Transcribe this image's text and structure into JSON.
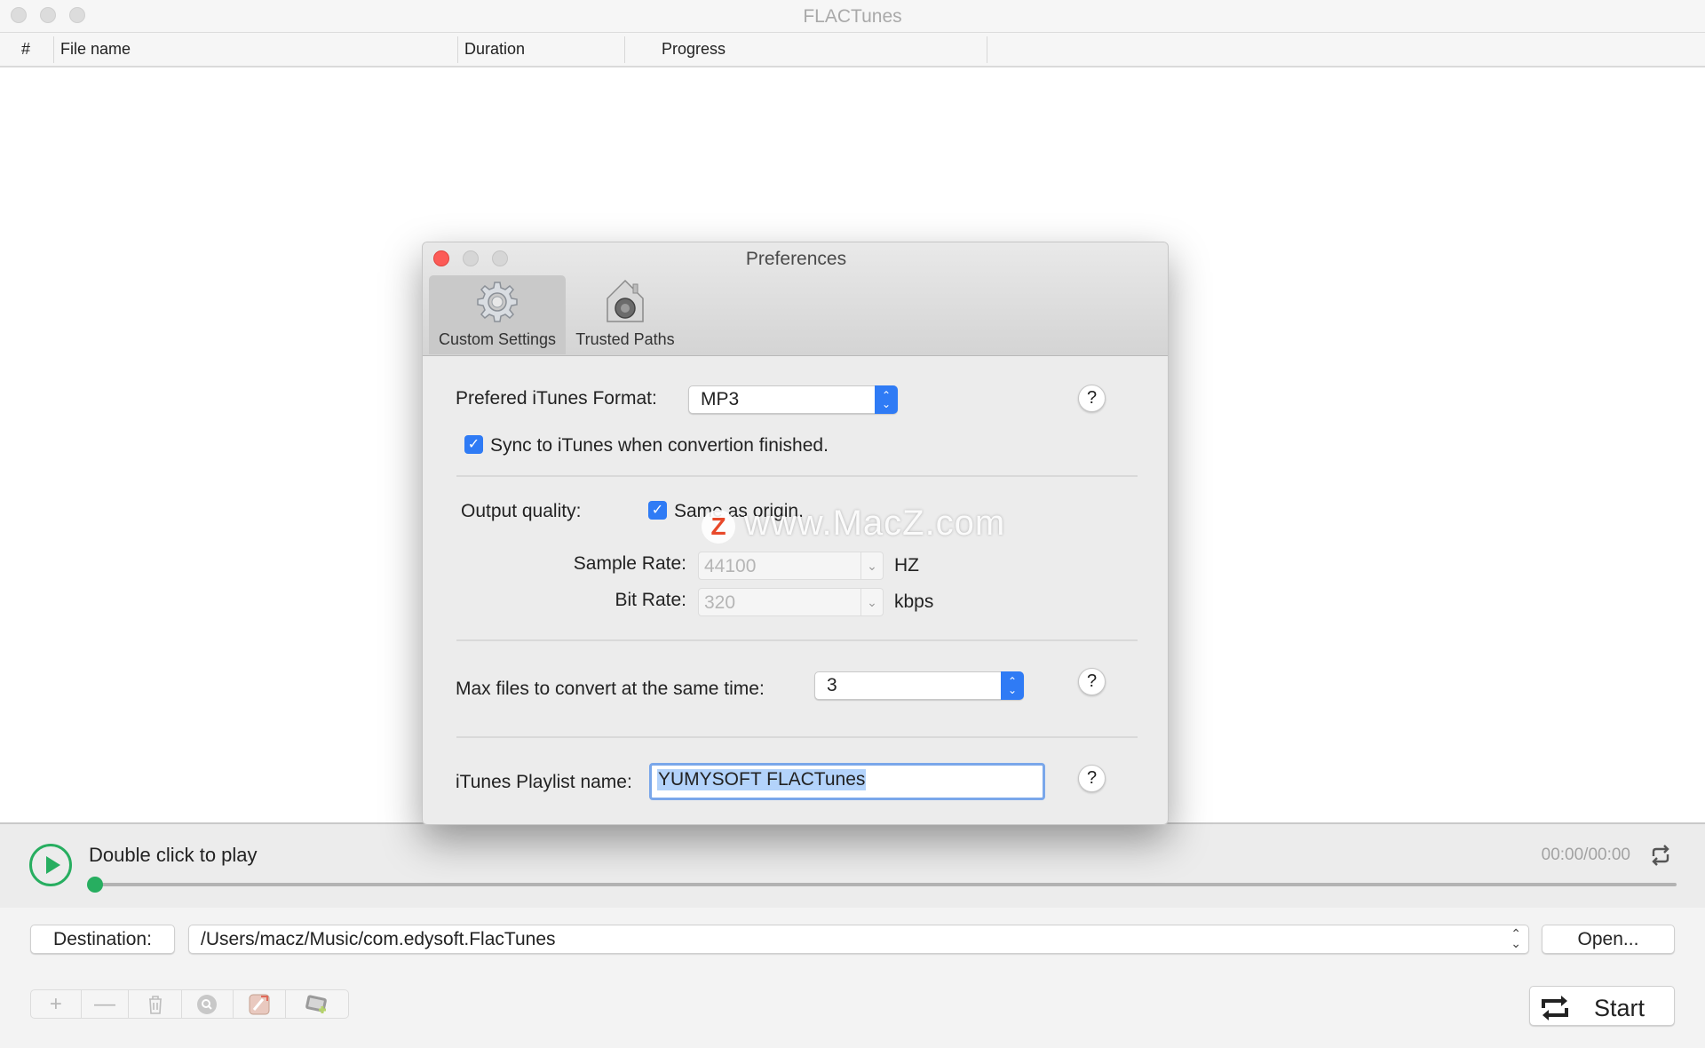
{
  "window": {
    "title": "FLACTunes"
  },
  "table": {
    "columns": [
      "#",
      "File name",
      "Duration",
      "Progress"
    ],
    "rows": []
  },
  "player": {
    "status": "Double click to play",
    "time": "00:00/00:00",
    "progress": 0
  },
  "destination": {
    "label": "Destination:",
    "path": "/Users/macz/Music/com.edysoft.FlacTunes",
    "open_label": "Open..."
  },
  "toolbar": {
    "buttons": [
      "add-icon",
      "remove-icon",
      "trash-icon",
      "search-icon",
      "edit-tags-icon",
      "itunes-add-icon"
    ],
    "start_label": "Start"
  },
  "preferences": {
    "title": "Preferences",
    "tabs": [
      {
        "label": "Custom Settings",
        "icon": "gear-icon",
        "selected": true
      },
      {
        "label": "Trusted Paths",
        "icon": "vault-house-icon",
        "selected": false
      }
    ],
    "format_label": "Prefered iTunes Format:",
    "format_value": "MP3",
    "sync_label": "Sync to iTunes when convertion finished.",
    "sync_checked": true,
    "output_quality_label": "Output quality:",
    "same_as_origin_label": "Same as origin.",
    "same_as_origin_checked": true,
    "sample_rate_label": "Sample Rate:",
    "sample_rate_value": "44100",
    "sample_rate_unit": "HZ",
    "bit_rate_label": "Bit Rate:",
    "bit_rate_value": "320",
    "bit_rate_unit": "kbps",
    "max_files_label": "Max files to convert at the same time:",
    "max_files_value": "3",
    "playlist_label": "iTunes Playlist name:",
    "playlist_value": "YUMYSOFT FLACTunes",
    "help_label": "?"
  },
  "watermark": {
    "logo": "Z",
    "text": "www.MacZ.com"
  },
  "colors": {
    "accent": "#2f7bf5",
    "play_green": "#27ae60",
    "close_red": "#fc5b57"
  }
}
